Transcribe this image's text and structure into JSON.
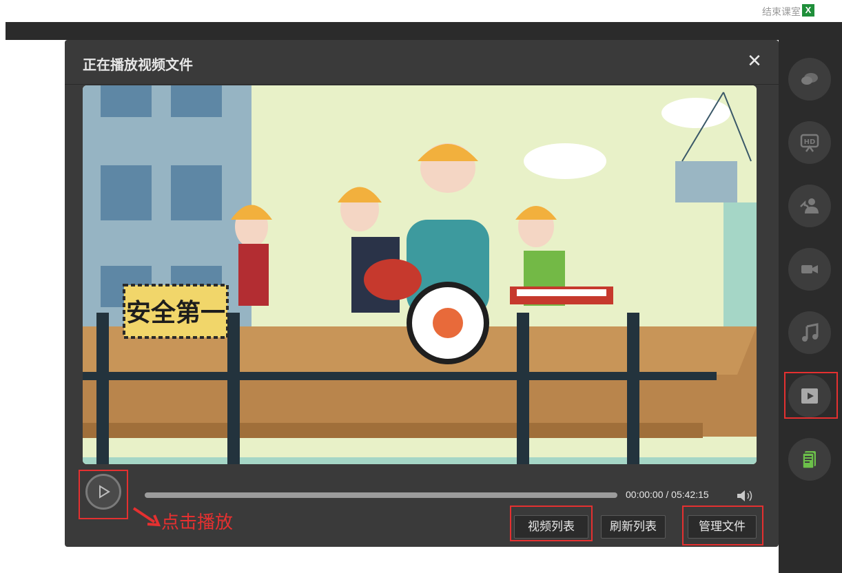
{
  "topbar": {
    "text": "结束课室",
    "excel_icon": "X"
  },
  "dialog": {
    "title": "正在播放视频文件",
    "close_symbol": "✕",
    "video_sign": "安全第一",
    "hint": "点击播放",
    "time": "00:00:00 / 05:42:15",
    "progress_fraction": 0,
    "buttons": {
      "video_list": "视频列表",
      "refresh_list": "刷新列表",
      "manage_files": "管理文件"
    }
  },
  "right_panel": {
    "items": [
      {
        "icon": "chat-icon"
      },
      {
        "icon": "hd-icon"
      },
      {
        "icon": "user-share-icon"
      },
      {
        "icon": "video-camera-icon"
      },
      {
        "icon": "music-note-icon"
      },
      {
        "icon": "play-icon",
        "highlighted": true
      },
      {
        "icon": "document-icon",
        "color": "#6cc04a"
      }
    ]
  },
  "colors": {
    "highlight": "#e53030",
    "accent_green": "#6cc04a"
  }
}
